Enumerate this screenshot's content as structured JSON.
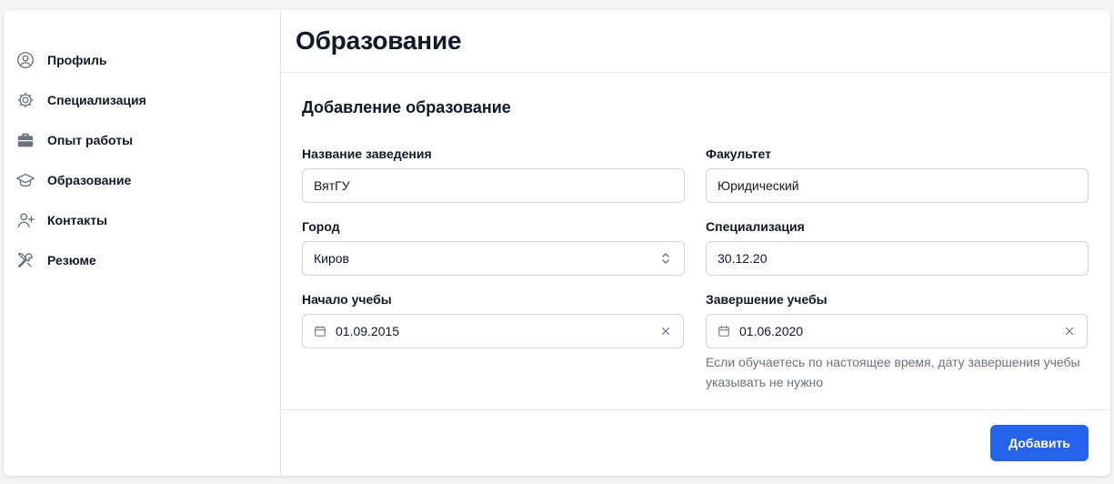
{
  "sidebar": {
    "items": [
      {
        "label": "Профиль",
        "icon": "user-circle-icon"
      },
      {
        "label": "Специализация",
        "icon": "cog-icon"
      },
      {
        "label": "Опыт работы",
        "icon": "briefcase-icon"
      },
      {
        "label": "Образование",
        "icon": "academic-cap-icon"
      },
      {
        "label": "Контакты",
        "icon": "user-add-icon"
      },
      {
        "label": "Резюме",
        "icon": "tools-icon"
      }
    ]
  },
  "header": {
    "title": "Образование"
  },
  "form": {
    "section_title": "Добавление образование",
    "institution": {
      "label": "Название заведения",
      "value": "ВятГУ"
    },
    "faculty": {
      "label": "Факультет",
      "value": "Юридический"
    },
    "city": {
      "label": "Город",
      "value": "Киров"
    },
    "specialization": {
      "label": "Специализация",
      "value": "30.12.20"
    },
    "start": {
      "label": "Начало учебы",
      "value": "01.09.2015"
    },
    "end": {
      "label": "Завершение учебы",
      "value": "01.06.2020",
      "help": "Если обучаетесь по настоящее время, дату завершения учебы указывать не нужно"
    }
  },
  "footer": {
    "add_button": "Добавить"
  },
  "colors": {
    "accent": "#2563eb",
    "background": "#f3f4f6",
    "border": "#e5e7eb"
  }
}
